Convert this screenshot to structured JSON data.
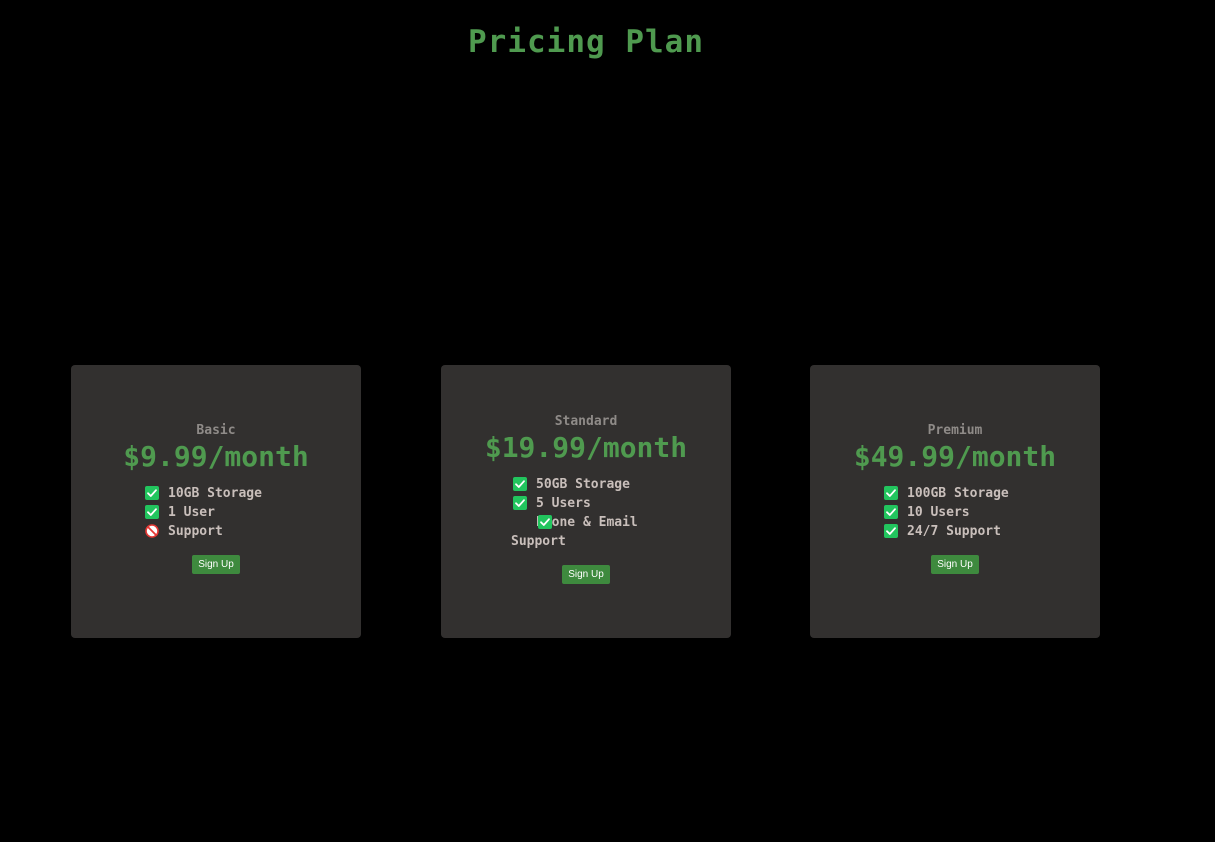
{
  "header": {
    "title": "Pricing Plan"
  },
  "plans": [
    {
      "name": "Basic",
      "price": "$9.99/month",
      "features": [
        {
          "label": "10GB Storage",
          "icon": "check-icon"
        },
        {
          "label": "1 User",
          "icon": "check-icon"
        },
        {
          "label": "Support",
          "icon": "no-entry-icon"
        }
      ],
      "button_label": "Sign Up"
    },
    {
      "name": "Standard",
      "price": "$19.99/month",
      "features": [
        {
          "label": "50GB Storage",
          "icon": "check-icon"
        },
        {
          "label": "5 Users",
          "icon": "check-icon"
        },
        {
          "label": "Phone & Email Support",
          "icon": "check-icon"
        }
      ],
      "button_label": "Sign Up"
    },
    {
      "name": "Premium",
      "price": "$49.99/month",
      "features": [
        {
          "label": "100GB Storage",
          "icon": "check-icon"
        },
        {
          "label": "10 Users",
          "icon": "check-icon"
        },
        {
          "label": "24/7 Support",
          "icon": "check-icon"
        }
      ],
      "button_label": "Sign Up"
    }
  ],
  "colors": {
    "background": "#000000",
    "card": "#32302f",
    "accent_green": "#4f9a4f",
    "check_green": "#22c55e",
    "no_red": "#e53935",
    "button": "#3e8a3e"
  }
}
